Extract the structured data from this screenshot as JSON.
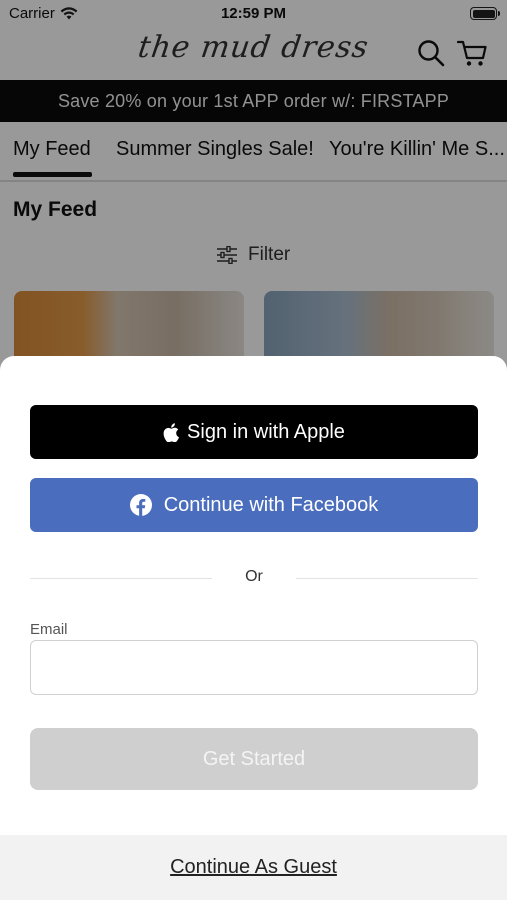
{
  "status_bar": {
    "carrier": "Carrier",
    "time": "12:59 PM"
  },
  "header": {
    "logo": "the mud dress",
    "icons": [
      "search-icon",
      "cart-icon"
    ]
  },
  "promo": {
    "text": "Save 20% on your 1st APP order w/: FIRSTAPP"
  },
  "tabs": [
    {
      "label": "My Feed",
      "active": true
    },
    {
      "label": "Summer Singles Sale!"
    },
    {
      "label": "You're Killin' Me S..."
    }
  ],
  "feed": {
    "title": "My Feed",
    "filter_label": "Filter"
  },
  "sheet": {
    "apple_label": "Sign in with Apple",
    "facebook_label": "Continue with Facebook",
    "or_label": "Or",
    "email_label": "Email",
    "email_value": "",
    "get_started_label": "Get Started",
    "guest_label": "Continue As Guest"
  },
  "colors": {
    "facebook": "#4a6dbd",
    "promo_bg": "#0a0a0a",
    "disabled_button": "#cfcfcf",
    "guest_bar": "#f2f2f2"
  }
}
